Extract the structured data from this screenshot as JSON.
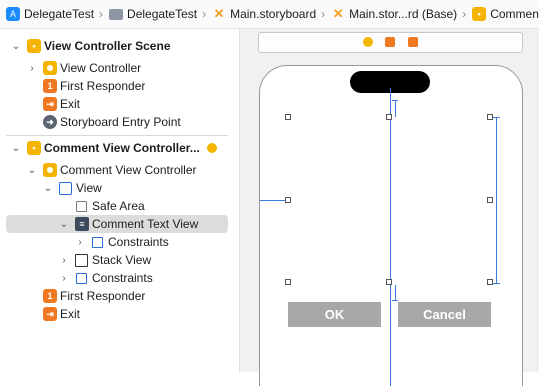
{
  "jumpbar": {
    "crumbs": [
      {
        "label": "DelegateTest",
        "icon": "app-icon"
      },
      {
        "label": "DelegateTest",
        "icon": "folder-icon"
      },
      {
        "label": "Main.storyboard",
        "icon": "storyboard-icon"
      },
      {
        "label": "Main.stor...rd (Base)",
        "icon": "storyboard-icon"
      },
      {
        "label": "Commen...l",
        "icon": "scene-icon"
      }
    ]
  },
  "outline": {
    "scene1": {
      "title": "View Controller Scene",
      "items": [
        "View Controller",
        "First Responder",
        "Exit",
        "Storyboard Entry Point"
      ]
    },
    "scene2": {
      "title": "Comment View Controller...",
      "controller": "Comment View Controller",
      "view": "View",
      "safe_area": "Safe Area",
      "text_view": "Comment Text View",
      "tv_constraints": "Constraints",
      "stack_view": "Stack View",
      "constraints": "Constraints",
      "first_responder": "First Responder",
      "exit": "Exit"
    }
  },
  "canvas": {
    "ok_label": "OK",
    "cancel_label": "Cancel"
  },
  "colors": {
    "accent_yellow": "#f5b400",
    "accent_orange": "#f07820",
    "constraint_blue": "#3d7ae0",
    "selection": "#dcdcdc"
  }
}
